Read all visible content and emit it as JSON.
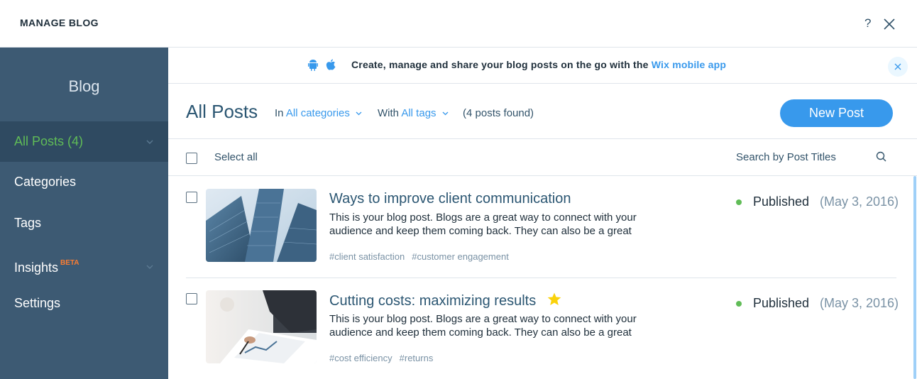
{
  "header": {
    "title": "MANAGE BLOG",
    "help_label": "?",
    "close_icon": "close-icon"
  },
  "sidebar": {
    "brand": "Blog",
    "items": [
      {
        "label": "All Posts (4)",
        "active": true
      },
      {
        "label": "Categories"
      },
      {
        "label": "Tags"
      },
      {
        "label": "Insights",
        "badge": "BETA"
      },
      {
        "label": "Settings"
      }
    ]
  },
  "banner": {
    "text": "Create, manage and share your blog posts on the go with the ",
    "link": "Wix mobile app"
  },
  "posts_header": {
    "title": "All Posts",
    "category_prefix": "In",
    "category_value": "All categories",
    "tag_prefix": "With",
    "tag_value": "All tags",
    "found": "(4 posts found)",
    "new_post": "New Post"
  },
  "toolbar": {
    "select_all": "Select all",
    "search_placeholder": "Search by Post Titles"
  },
  "posts": [
    {
      "title": "Ways to improve client communication",
      "excerpt": "This is your blog post. Blogs are a great way to connect with your audience and keep them coming back. They can also be a great",
      "tags": [
        "#client satisfaction",
        "#customer engagement"
      ],
      "status": "Published",
      "date": "(May 3, 2016)",
      "featured": false
    },
    {
      "title": "Cutting costs: maximizing results",
      "excerpt": "This is your blog post. Blogs are a great way to connect with your audience and keep them coming back. They can also be a great",
      "tags": [
        "#cost efficiency",
        "#returns"
      ],
      "status": "Published",
      "date": "(May 3, 2016)",
      "featured": true
    }
  ],
  "colors": {
    "sidebar_bg": "#3d5a73",
    "sidebar_active_bg": "#2f4a61",
    "accent": "#3899ec",
    "active_text": "#60bc57",
    "published_dot": "#60bc57",
    "beta_badge": "#fb7d33",
    "star": "#fad20a"
  }
}
